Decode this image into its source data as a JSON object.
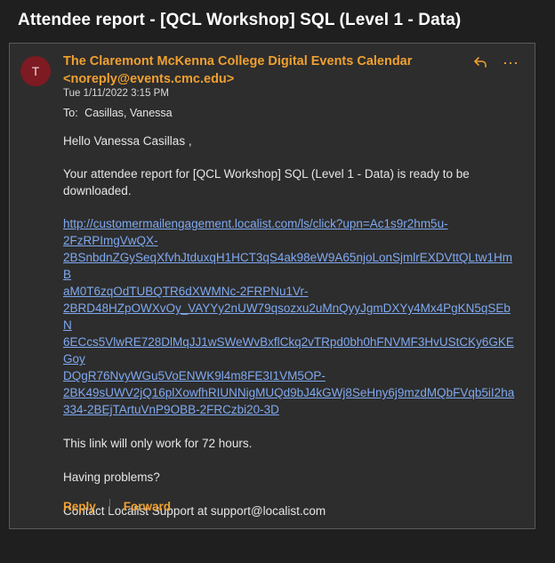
{
  "email": {
    "subject": "Attendee report - [QCL Workshop] SQL (Level 1 - Data)",
    "avatar_letter": "T",
    "sender_name": "The Claremont McKenna College Digital Events Calendar",
    "sender_email": "<noreply@events.cmc.edu>",
    "date": "Tue 1/11/2022 3:15 PM",
    "to_label": "To:",
    "to_value": "Casillas, Vanessa",
    "greeting": "Hello Vanessa Casillas ,",
    "intro": "Your attendee report for [QCL Workshop] SQL (Level 1 - Data) is ready to be downloaded.",
    "link_lines": [
      "http://customermailengagement.localist.com/ls/click?upn=Ac1s9r2hm5u-",
      "2FzRPImgVwQX-",
      "2BSnbdnZGySeqXfvhJtduxqH1HCT3qS4ak98eW9A65njoLonSjmlrEXDVttQLtw1HmB",
      "aM0T6zqOdTUBQTR6dXWMNc-2FRPNu1Vr-",
      "2BRD48HZpOWXvOy_VAYYy2nUW79qsozxu2uMnQyyJgmDXYy4Mx4PgKN5qSEbN",
      "6ECcs5VlwRE728DlMqJJ1wSWeWvBxflCkq2vTRpd0bh0hFNVMF3HvUStCKy6GKEGoy",
      "DQgR76NvyWGu5VoENWK9l4m8FE3I1VM5OP-",
      "2BK49sUWV2jQ16plXowfhRIUNNigMUQd9bJ4kGWj8SeHny6j9mzdMQbFVqb5iI2ha",
      "334-2BEjTArtuVnP9OBB-2FRCzbi20-3D"
    ],
    "notice": "This link will only work for 72 hours.",
    "problems": "Having problems?",
    "contact": "Contact Localist Support at support@localist.com"
  },
  "actions": {
    "reply": "Reply",
    "forward": "Forward",
    "reply_icon": "reply-icon",
    "more_icon": "more-icon"
  }
}
